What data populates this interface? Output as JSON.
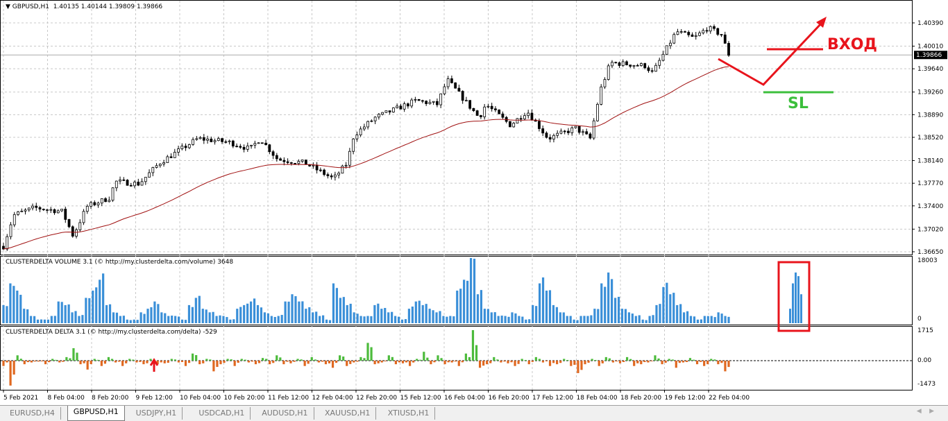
{
  "header": {
    "symbol": "GBPUSD,H1",
    "ohlc": "1.40135 1.40144 1.39809 1.39866"
  },
  "price_axis": {
    "ticks": [
      "1.40390",
      "1.40010",
      "1.39640",
      "1.39260",
      "1.38890",
      "1.38520",
      "1.38140",
      "1.37770",
      "1.37400",
      "1.37020",
      "1.36650"
    ],
    "current": "1.39866"
  },
  "volume_pane": {
    "title": "CLUSTERDELTA VOLUME 3.1 (© http://my.clusterdelta.com/volume) 3648",
    "max_label": "18003",
    "min_label": "0"
  },
  "delta_pane": {
    "title": "CLUSTERDELTA DELTA 3.1 (© http://my.clusterdelta.com/delta) -529",
    "max_label": "1715",
    "zero_label": "0.00",
    "min_label": "-1473"
  },
  "time_axis": [
    "5 Feb 2021",
    "8 Feb 04:00",
    "8 Feb 20:00",
    "9 Feb 12:00",
    "10 Feb 04:00",
    "10 Feb 20:00",
    "11 Feb 12:00",
    "12 Feb 04:00",
    "12 Feb 20:00",
    "15 Feb 12:00",
    "16 Feb 04:00",
    "16 Feb 20:00",
    "17 Feb 12:00",
    "18 Feb 04:00",
    "18 Feb 20:00",
    "19 Feb 12:00",
    "22 Feb 04:00"
  ],
  "annotations": {
    "entry": "ВХОД",
    "stop": "SL",
    "entry_color": "#e8141c",
    "stop_color": "#3cbf3c"
  },
  "tabs": [
    "EURUSD,H4",
    "GBPUSD,H1",
    "USDJPY,H1",
    "USDCAD,H1",
    "AUDUSD,H1",
    "XAUUSD,H1",
    "XTIUSD,H1"
  ],
  "active_tab": 1,
  "chart_data": {
    "type": "candlestick",
    "ylim": [
      1.3665,
      1.4039
    ],
    "close_path": [
      1.3674,
      1.3725,
      1.3737,
      1.3731,
      1.3691,
      1.3739,
      1.3754,
      1.378,
      1.3776,
      1.381,
      1.385,
      1.3844,
      1.3833,
      1.385,
      1.3816,
      1.381,
      1.3784,
      1.381,
      1.3855,
      1.3884,
      1.3912,
      1.3906,
      1.3946,
      1.3884,
      1.3906,
      1.3872,
      1.3895,
      1.385,
      1.3867,
      1.385,
      1.3929,
      1.3974,
      1.3969,
      1.3957,
      1.4025,
      1.4014,
      1.4031,
      1.402,
      1.3986
    ],
    "path_x_fraction": [
      0,
      0.014,
      0.043,
      0.081,
      0.096,
      0.115,
      0.148,
      0.153,
      0.187,
      0.215,
      0.268,
      0.311,
      0.34,
      0.354,
      0.378,
      0.416,
      0.455,
      0.474,
      0.483,
      0.512,
      0.569,
      0.598,
      0.612,
      0.656,
      0.665,
      0.699,
      0.722,
      0.751,
      0.789,
      0.809,
      0.823,
      0.837,
      0.885,
      0.895,
      0.928,
      0.952,
      0.971,
      0.99,
      1
    ],
    "volume_k": [
      5,
      11,
      9,
      4,
      2,
      1,
      1,
      2,
      6,
      5,
      3,
      2,
      7,
      9,
      12,
      5,
      3,
      2,
      1,
      1,
      3,
      4,
      6,
      3,
      2,
      2,
      1,
      5,
      7,
      4,
      3,
      2,
      2,
      1,
      4,
      5,
      6,
      5,
      3,
      2,
      2,
      6,
      8,
      6,
      4,
      3,
      2,
      1,
      11,
      7,
      5,
      3,
      2,
      2,
      5,
      4,
      3,
      2,
      1,
      4,
      6,
      5,
      4,
      3,
      2,
      2,
      9,
      12,
      18,
      8,
      4,
      3,
      2,
      2,
      3,
      2,
      1,
      5,
      11,
      9,
      5,
      3,
      2,
      1,
      2,
      2,
      4,
      11,
      14,
      7,
      4,
      3,
      2,
      1,
      2,
      5,
      10,
      8,
      5,
      3,
      2,
      1,
      2,
      2,
      3,
      2
    ],
    "delta": [
      -300,
      -1400,
      300,
      -200,
      -100,
      -50,
      -200,
      100,
      -100,
      200,
      700,
      -200,
      -500,
      100,
      -300,
      200,
      -100,
      -300,
      100,
      -100,
      -200,
      100,
      -200,
      -150,
      100,
      -100,
      -300,
      400,
      -200,
      100,
      -600,
      -200,
      100,
      -300,
      100,
      -100,
      -200,
      150,
      -200,
      300,
      -200,
      -150,
      100,
      -300,
      200,
      -100,
      -200,
      -400,
      300,
      -300,
      -100,
      200,
      1000,
      -200,
      -100,
      300,
      -200,
      -150,
      -300,
      100,
      500,
      -200,
      300,
      -200,
      -100,
      -300,
      400,
      1715,
      -400,
      -200,
      200,
      -100,
      -150,
      -300,
      100,
      -200,
      200,
      -100,
      -300,
      -200,
      100,
      -300,
      -700,
      -200,
      100,
      -300,
      200,
      -100,
      -150,
      200,
      -300,
      -200,
      -100,
      300,
      -200,
      100,
      -400,
      -100,
      150,
      -200,
      -300,
      100,
      -200,
      -600
    ]
  }
}
